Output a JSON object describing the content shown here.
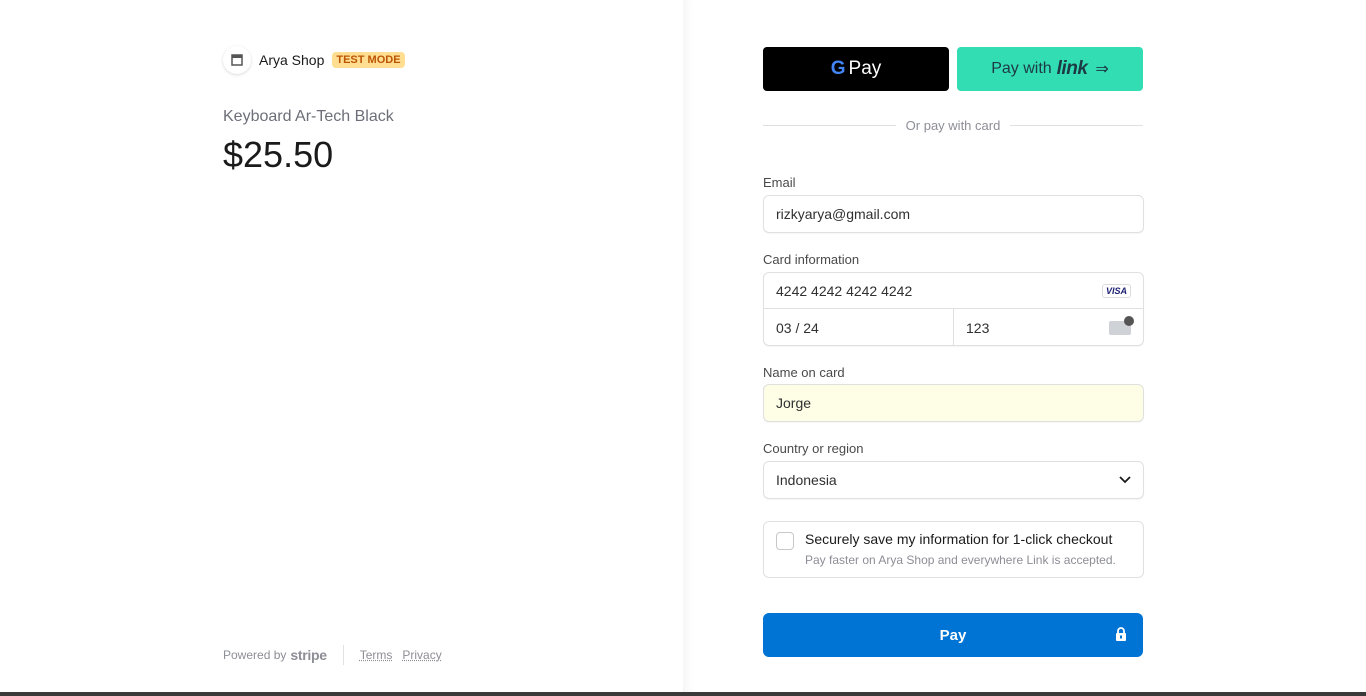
{
  "merchant": {
    "name": "Arya Shop",
    "badge": "TEST MODE",
    "logo_icon": "store-icon"
  },
  "product": {
    "name": "Keyboard Ar-Tech Black",
    "price": "$25.50"
  },
  "footer": {
    "powered_by": "Powered by",
    "stripe": "stripe",
    "terms": "Terms",
    "privacy": "Privacy"
  },
  "wallets": {
    "gpay_g": "G",
    "gpay_label": "Pay",
    "link_prefix": "Pay with",
    "link_word": "link",
    "link_arrow_icon": "double-arrow-icon"
  },
  "divider": "Or pay with card",
  "form": {
    "email_label": "Email",
    "email_value": "rizkyarya@gmail.com",
    "card_label": "Card information",
    "card_number": "4242 4242 4242 4242",
    "card_brand": "VISA",
    "expiry": "03 / 24",
    "cvc": "123",
    "name_label": "Name on card",
    "name_value": "Jorge",
    "country_label": "Country or region",
    "country_value": "Indonesia",
    "save_title": "Securely save my information for 1-click checkout",
    "save_sub": "Pay faster on Arya Shop and everywhere Link is accepted.",
    "pay_label": "Pay"
  },
  "colors": {
    "pay_button": "#0074d4",
    "link_button": "#33ddb3",
    "badge_bg": "#ffde92",
    "badge_fg": "#bb5504"
  }
}
